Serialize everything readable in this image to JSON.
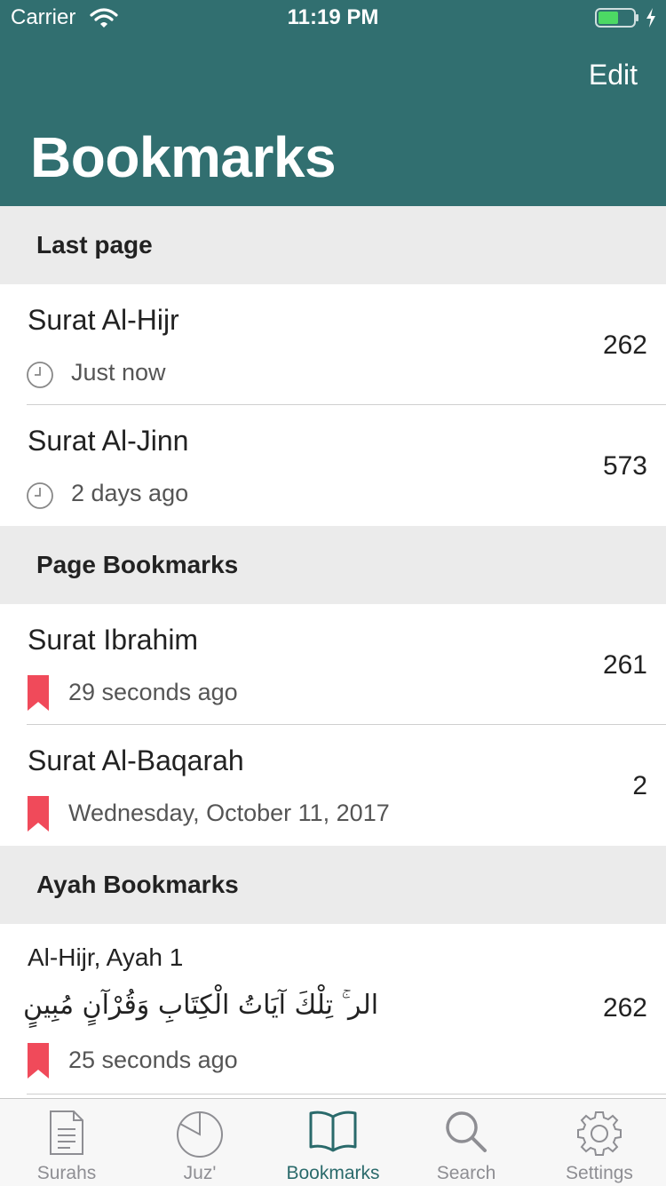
{
  "status_bar": {
    "carrier": "Carrier",
    "time": "11:19 PM"
  },
  "header": {
    "edit_label": "Edit",
    "title": "Bookmarks"
  },
  "sections": {
    "last_page": {
      "title": "Last page",
      "items": [
        {
          "title": "Surat Al-Hijr",
          "time": "Just now",
          "page": "262"
        },
        {
          "title": "Surat Al-Jinn",
          "time": "2 days ago",
          "page": "573"
        }
      ]
    },
    "page_bookmarks": {
      "title": "Page Bookmarks",
      "items": [
        {
          "title": "Surat Ibrahim",
          "time": "29 seconds ago",
          "page": "261"
        },
        {
          "title": "Surat Al-Baqarah",
          "time": "Wednesday, October 11, 2017",
          "page": "2"
        }
      ]
    },
    "ayah_bookmarks": {
      "title": "Ayah Bookmarks",
      "items": [
        {
          "title": "Al-Hijr, Ayah 1",
          "text": "الر ۚ تِلْكَ آيَاتُ الْكِتَابِ وَقُرْآنٍ مُبِينٍ",
          "time": "25 seconds ago",
          "page": "262"
        }
      ]
    }
  },
  "tabbar": {
    "tabs": [
      {
        "label": "Surahs",
        "icon": "document-icon"
      },
      {
        "label": "Juz'",
        "icon": "pie-icon"
      },
      {
        "label": "Bookmarks",
        "icon": "book-icon",
        "active": true
      },
      {
        "label": "Search",
        "icon": "search-icon"
      },
      {
        "label": "Settings",
        "icon": "gear-icon"
      }
    ]
  },
  "colors": {
    "header": "#316f70",
    "accent": "#2a6a6b",
    "bookmark": "#f04a5a"
  }
}
